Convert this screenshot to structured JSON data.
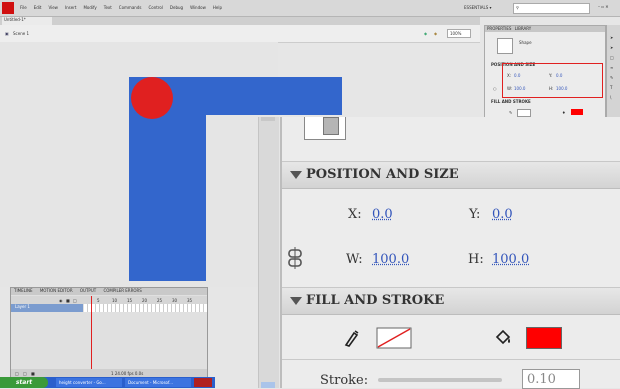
{
  "menubar": {
    "items": [
      "File",
      "Edit",
      "View",
      "Insert",
      "Modify",
      "Text",
      "Commands",
      "Control",
      "Debug",
      "Window",
      "Help"
    ],
    "workspace": "ESSENTIALS ▾",
    "search_icon": "search-icon"
  },
  "document_tab": "Untitled-1*",
  "scene": {
    "label": "Scene 1",
    "zoom": "100%"
  },
  "small_panel": {
    "tabs": [
      "PROPERTIES",
      "LIBRARY"
    ],
    "shape_label": "Shape",
    "position_header": "POSITION AND SIZE",
    "x_label": "X:",
    "x_value": "0.0",
    "y_label": "Y:",
    "y_value": "0.0",
    "w_label": "W:",
    "w_value": "100.0",
    "h_label": "H:",
    "h_value": "100.0",
    "fill_header": "FILL AND STROKE"
  },
  "properties": {
    "position_header": "POSITION AND SIZE",
    "x_label": "X:",
    "x_value": "0.0",
    "y_label": "Y:",
    "y_value": "0.0",
    "w_label": "W:",
    "w_value": "100.0",
    "h_label": "H:",
    "h_value": "100.0",
    "fill_header": "FILL AND STROKE",
    "stroke_label": "Stroke:",
    "stroke_value": "0.10",
    "fill_color": "#ff0000"
  },
  "timeline": {
    "tabs": [
      "TIMELINE",
      "MOTION EDITOR",
      "OUTPUT",
      "COMPILER ERRORS"
    ],
    "layer_name": "Layer 1",
    "ruler": [
      "5",
      "10",
      "15",
      "20",
      "25",
      "30",
      "35"
    ],
    "footer": "1  24.00 fps  0.0s"
  },
  "taskbar": {
    "start": "start",
    "items": [
      "height converter - Go...",
      "Document - Microsof..."
    ]
  },
  "colors": {
    "stage_shape": "#3366cc",
    "circle": "#e02020",
    "highlight": "#e02020"
  }
}
